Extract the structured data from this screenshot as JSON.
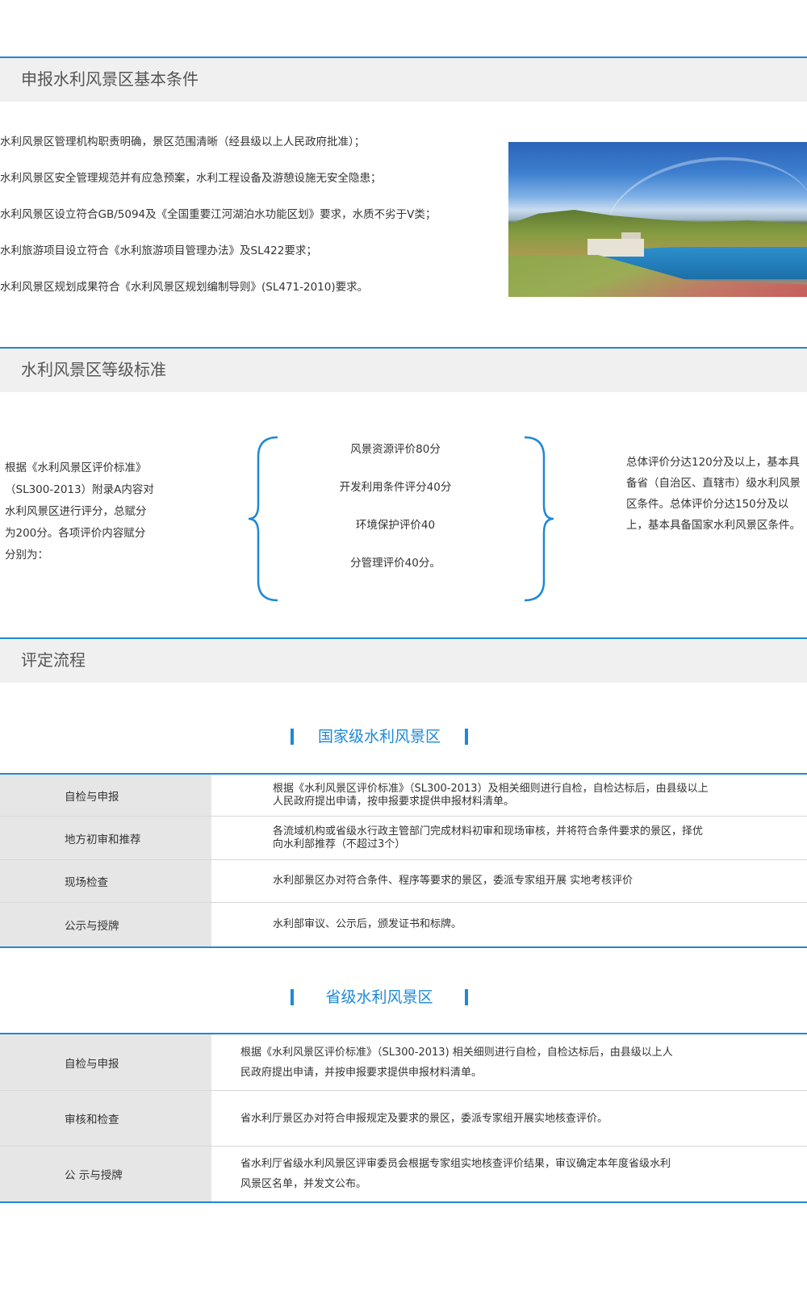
{
  "sections": {
    "basic": {
      "title": "申报水利风景区基本条件",
      "items": [
        "水利风景区管理机构职责明确，景区范围清晰（经县级以上人民政府批准）；",
        "水利风景区安全管理规范并有应急预案，水利工程设备及游憩设施无安全隐患；",
        "水利风景区设立符合GB/5094及《全国重要江河湖泊水功能区划》要求，水质不劣于V类；",
        "水利旅游项目设立符合《水利旅游项目管理办法》及SL422要求；",
        "水利风景区规划成果符合《水利风景区规划编制导则》(SL471-2010)要求。"
      ]
    },
    "grade": {
      "title": "水利风景区等级标准",
      "left_text": "根据《水利风景区评价标准》（SL300-2013）附录A内容对水利风景区进行评分，总赋分为200分。各项评价内容赋分分别为：",
      "items": [
        "风景资源评价80分",
        "开发利用条件评分40分",
        "环境保护评价40",
        "分管理评价40分。"
      ],
      "right_text": "总体评价分达120分及以上，基本具备省（自治区、直辖市）级水利风景区条件。总体评价分达150分及以上，基本具备国家水利风景区条件。"
    },
    "process": {
      "title": "评定流程",
      "national": {
        "title": "国家级水利风景区",
        "rows": [
          {
            "step": "自检与申报",
            "desc": "根据《水利风景区评价标准》（SL300-2013）及相关细则进行自检，自检达标后，由县级以上人民政府提出申请，按申报要求提供申报材料清单。"
          },
          {
            "step": "地方初审和推荐",
            "desc": "各流域机构或省级水行政主管部门完成材料初审和现场审核，并将符合条件要求的景区，择优向水利部推荐（不超过3个）"
          },
          {
            "step": "现场检查",
            "desc": "水利部景区办对符合条件、程序等要求的景区，委派专家组开展 实地考核评价"
          },
          {
            "step": "公示与授牌",
            "desc": "水利部审议、公示后，颁发证书和标牌。"
          }
        ]
      },
      "provincial": {
        "title": "省级水利风景区",
        "rows": [
          {
            "step": "自检与申报",
            "desc": "根据《水利风景区评价标准》（SL300-2013) 相关细则进行自检，自检达标后，由县级以上人民政府提出申请，并按申报要求提供申报材料清单。"
          },
          {
            "step": "审核和检查",
            "desc": "省水利厅景区办对符合申报规定及要求的景区，委派专家组开展实地核查评价。"
          },
          {
            "step": "公 示与授牌",
            "desc": "省水利厅省级水利风景区评审委员会根据专家组实地核查评价结果，审议确定本年度省级水利风景区名单，并发文公布。"
          }
        ]
      }
    }
  },
  "colors": {
    "accent": "#1e88d8",
    "header_bg": "#f0f0f0",
    "label_bg": "#e6e6e6"
  }
}
